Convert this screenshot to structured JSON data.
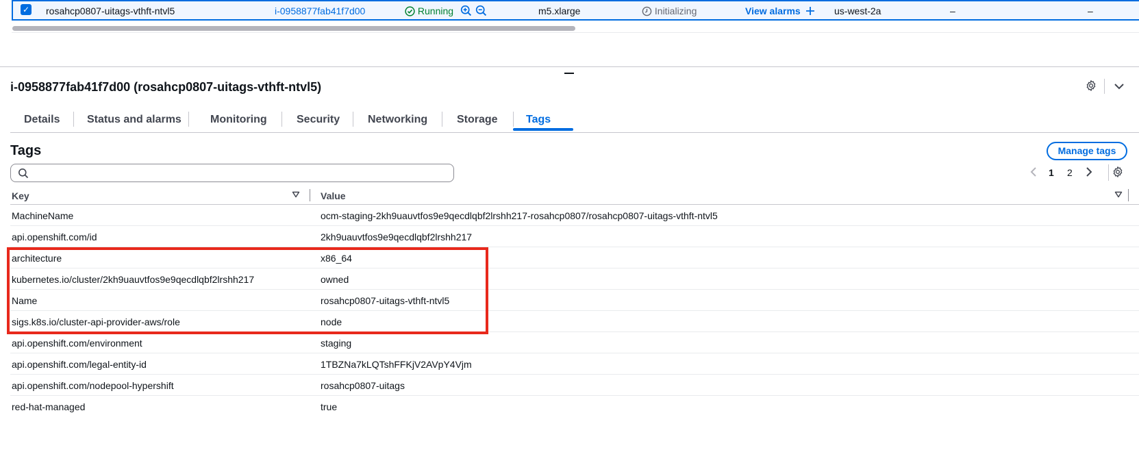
{
  "instance_row": {
    "name": "rosahcp0807-uitags-vthft-ntvl5",
    "instance_id": "i-0958877fab41f7d00",
    "state": "Running",
    "instance_type": "m5.xlarge",
    "status_check": "Initializing",
    "alarms_link": "View alarms",
    "availability_zone": "us-west-2a",
    "public_dns": "–",
    "public_ip": "–"
  },
  "details": {
    "title": "i-0958877fab41f7d00 (rosahcp0807-uitags-vthft-ntvl5)"
  },
  "tabs": [
    {
      "label": "Details"
    },
    {
      "label": "Status and alarms"
    },
    {
      "label": "Monitoring"
    },
    {
      "label": "Security"
    },
    {
      "label": "Networking"
    },
    {
      "label": "Storage"
    },
    {
      "label": "Tags"
    }
  ],
  "active_tab": "Tags",
  "tags_panel": {
    "title": "Tags",
    "manage_button": "Manage tags",
    "search_placeholder": "",
    "pagination": {
      "pages": [
        "1",
        "2"
      ],
      "current": "1"
    },
    "columns": {
      "key": "Key",
      "value": "Value"
    },
    "rows": [
      {
        "key": "MachineName",
        "value": "ocm-staging-2kh9uauvtfos9e9qecdlqbf2lrshh217-rosahcp0807/rosahcp0807-uitags-vthft-ntvl5"
      },
      {
        "key": "api.openshift.com/id",
        "value": "2kh9uauvtfos9e9qecdlqbf2lrshh217"
      },
      {
        "key": "architecture",
        "value": "x86_64"
      },
      {
        "key": "kubernetes.io/cluster/2kh9uauvtfos9e9qecdlqbf2lrshh217",
        "value": "owned"
      },
      {
        "key": "Name",
        "value": "rosahcp0807-uitags-vthft-ntvl5"
      },
      {
        "key": "sigs.k8s.io/cluster-api-provider-aws/role",
        "value": "node"
      },
      {
        "key": "api.openshift.com/environment",
        "value": "staging"
      },
      {
        "key": "api.openshift.com/legal-entity-id",
        "value": "1TBZNa7kLQTshFFKjV2AVpY4Vjm"
      },
      {
        "key": "api.openshift.com/nodepool-hypershift",
        "value": "rosahcp0807-uitags"
      },
      {
        "key": "red-hat-managed",
        "value": "true"
      }
    ]
  },
  "colors": {
    "accent": "#006ce0",
    "success": "#00802f",
    "highlight": "#e8291c"
  },
  "icons": {
    "checkbox": "checkbox-checked-icon",
    "running": "check-circle-icon",
    "zoom_in": "zoom-in-icon",
    "zoom_out": "zoom-out-icon",
    "status": "clock-icon",
    "add": "plus-icon",
    "settings": "gear-icon",
    "collapse": "chevron-down-icon",
    "search": "search-icon",
    "sort": "caret-down-icon",
    "prev": "chevron-left-icon",
    "next": "chevron-right-icon"
  }
}
